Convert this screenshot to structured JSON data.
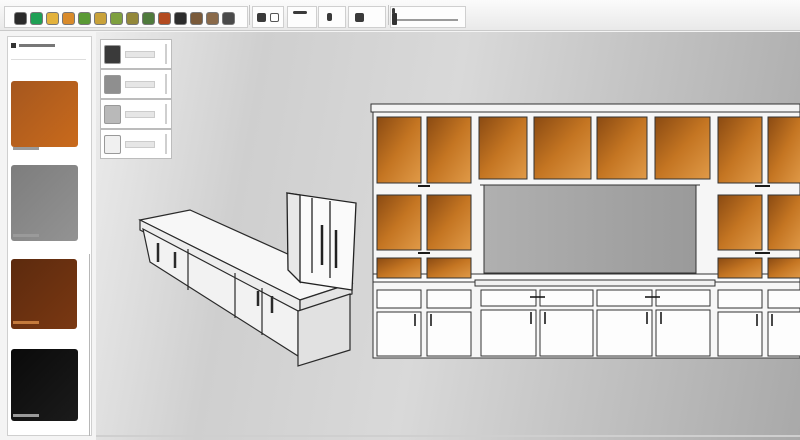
{
  "toolbar": {
    "color_chips": [
      "#2a2a2a",
      "#1fa055",
      "#e3b23c",
      "#d98b2b",
      "#5a9a35",
      "#c9a23a",
      "#7ea03f",
      "#93883a",
      "#4f7a3c",
      "#b34a1f",
      "#2c2c2c",
      "#7a5a3a",
      "#8a6a4a",
      "#4a4a4a"
    ]
  },
  "swatch_panel": {
    "swatches": [
      {
        "name": "walnut",
        "color": "#a5571e",
        "color2": "#c96a1c"
      },
      {
        "name": "gray",
        "color": "#7d7d7d",
        "color2": "#939393"
      },
      {
        "name": "dark-brown",
        "color": "#5c2a0e",
        "color2": "#7a3812"
      },
      {
        "name": "black",
        "color": "#0a0a0a",
        "color2": "#1b1b1b"
      }
    ]
  },
  "thumbnails": {
    "items": [
      {
        "name": "dark",
        "fill": "#3a3a3a"
      },
      {
        "name": "gray",
        "fill": "#8f8f8f"
      },
      {
        "name": "light-gray",
        "fill": "#b9b9b9"
      },
      {
        "name": "white",
        "fill": "#f0f0f0"
      }
    ]
  },
  "scene": {
    "wood_color": "#b36a1d",
    "wood_light": "#cf8a3a",
    "panel_color": "#9d9d9d"
  }
}
